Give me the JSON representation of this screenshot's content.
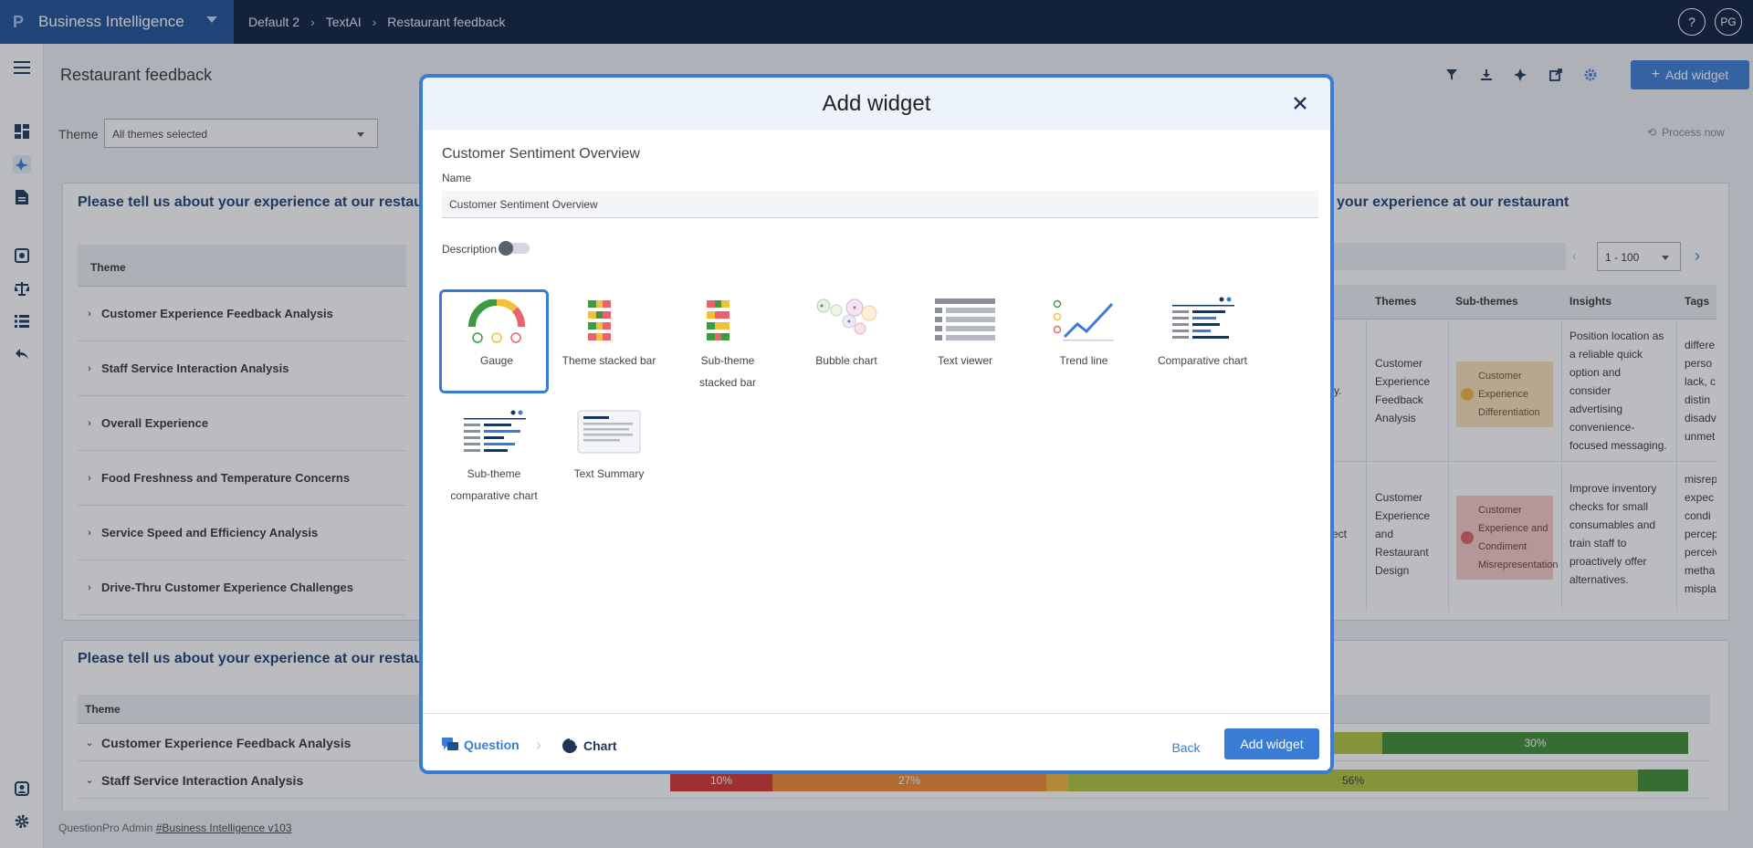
{
  "topbar": {
    "brand": "Business Intelligence",
    "breadcrumbs": [
      "Default 2",
      "TextAI",
      "Restaurant feedback"
    ],
    "help": "?",
    "avatar": "PG"
  },
  "page": {
    "title": "Restaurant feedback",
    "theme_label": "Theme",
    "theme_value": "All themes selected",
    "process_now": "Process now",
    "add_widget": "Add widget"
  },
  "card1": {
    "title_left": "Please tell us about your experience at our restaura",
    "title_right": "your experience at our restaurant",
    "col_theme": "Theme",
    "rows": [
      "Customer Experience Feedback Analysis",
      "Staff Service Interaction Analysis",
      "Overall Experience",
      "Food Freshness and Temperature Concerns",
      "Service Speed and Efficiency Analysis",
      "Drive-Thru Customer Experience Challenges"
    ],
    "pager": "1 - 100",
    "right_cols": [
      "Themes",
      "Sub-themes",
      "Insights",
      "Tags"
    ],
    "right_rows": [
      {
        "cut": "y.",
        "themes": [
          "Customer",
          "Experience",
          "Feedback",
          "Analysis"
        ],
        "sub": [
          "Customer",
          "Experience",
          "Differentiation"
        ],
        "insights": [
          "Position location as",
          "a reliable quick",
          "option and",
          "consider",
          "advertising",
          "convenience-",
          "focused messaging."
        ],
        "tags": [
          "differe",
          "perso",
          "lack, c",
          "distin",
          "disadv",
          "unmet"
        ]
      },
      {
        "cut": "ect",
        "themes": [
          "Customer",
          "Experience",
          "and",
          "Restaurant",
          "Design"
        ],
        "sub": [
          "Customer",
          "Experience and",
          "Condiment",
          "Misrepresentation"
        ],
        "insights": [
          "Improve inventory",
          "checks for small",
          "consumables and",
          "train staff to",
          "proactively offer",
          "alternatives."
        ],
        "tags": [
          "misrep",
          "expec",
          "condi",
          "percep",
          "perceiv",
          "metha",
          "mispla"
        ]
      }
    ]
  },
  "card2": {
    "title_left": "Please tell us about your experience at our restaura",
    "col_theme": "Theme",
    "rows": [
      "Customer Experience Feedback Analysis",
      "Staff Service Interaction Analysis"
    ],
    "bars": [
      {
        "segments": [
          {
            "color": "#b2c43a",
            "label": ""
          },
          {
            "color": "#3d8b2f",
            "label": "30%"
          }
        ]
      },
      {
        "segments": [
          {
            "color": "#d8312e",
            "label": "10%"
          },
          {
            "color": "#f08a2b",
            "label": "27%"
          },
          {
            "color": "#f3b63a",
            "label": ""
          },
          {
            "color": "#b2c43a",
            "label": "56%"
          },
          {
            "color": "#3d8b2f",
            "label": ""
          }
        ]
      }
    ]
  },
  "footer": {
    "text": "QuestionPro Admin",
    "link": "#Business Intelligence v103"
  },
  "modal": {
    "title": "Add widget",
    "widget_name": "Customer Sentiment Overview",
    "name_label": "Name",
    "name_value": "Customer Sentiment Overview",
    "description_label": "Description",
    "types": [
      {
        "id": "gauge",
        "label": "Gauge",
        "selected": true
      },
      {
        "id": "theme-stacked-bar",
        "label": "Theme stacked bar",
        "selected": false
      },
      {
        "id": "sub-theme-stacked-bar",
        "label": "Sub-theme stacked bar",
        "selected": false
      },
      {
        "id": "bubble-chart",
        "label": "Bubble chart",
        "selected": false
      },
      {
        "id": "text-viewer",
        "label": "Text viewer",
        "selected": false
      },
      {
        "id": "trend-line",
        "label": "Trend line",
        "selected": false
      },
      {
        "id": "comparative-chart",
        "label": "Comparative chart",
        "selected": false
      },
      {
        "id": "sub-theme-comparative-chart",
        "label": "Sub-theme comparative chart",
        "selected": false
      },
      {
        "id": "text-summary",
        "label": "Text Summary",
        "selected": false
      }
    ],
    "steps": {
      "question": "Question",
      "chart": "Chart"
    },
    "back": "Back",
    "add": "Add widget"
  },
  "colors": {
    "accent": "#3a7bd5",
    "nav": "#0b1b3a",
    "brand": "#1d4f95"
  }
}
